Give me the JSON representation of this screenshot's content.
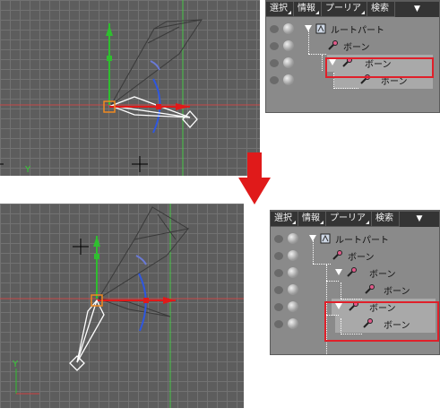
{
  "tabs": {
    "select": "選択",
    "info": "情報",
    "primitive": "プーリア",
    "search": "検索",
    "more_arrow": "▼"
  },
  "panel_top": {
    "rows": [
      {
        "label": "ルートパート",
        "type": "root"
      },
      {
        "label": "ボーン",
        "type": "bone"
      },
      {
        "label": "ボーン",
        "type": "bone",
        "selected": true
      },
      {
        "label": "ボーン",
        "type": "bone"
      }
    ]
  },
  "panel_bottom": {
    "rows": [
      {
        "label": "ルートパート",
        "type": "root"
      },
      {
        "label": "ボーン",
        "type": "bone"
      },
      {
        "label": "ボーン",
        "type": "bone"
      },
      {
        "label": "ボーン",
        "type": "bone"
      },
      {
        "label": "ボーン",
        "type": "bone",
        "selected": true
      },
      {
        "label": "ボーン",
        "type": "bone"
      }
    ]
  },
  "viewport_axis_label": "Y",
  "colors": {
    "viewport_bg": "#5d5d5d",
    "grid": "#727272",
    "highlight_box": "#e0202a",
    "y_axis": "#2fbf2f",
    "x_axis": "#e03030",
    "rotate_ring": "#2e57e0",
    "arrow": "#e01a1a"
  }
}
